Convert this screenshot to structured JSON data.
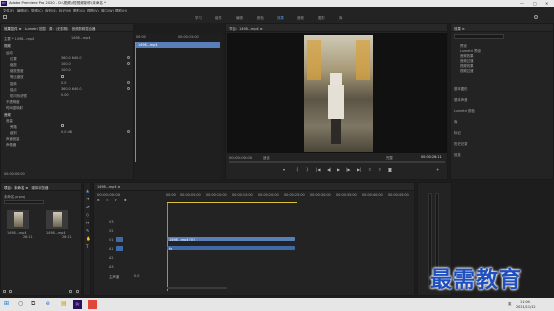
{
  "window": {
    "title": "Adobe Premiere Pro 2020 - D:\\视频\\\\短视频制作\\未命名 *",
    "minimize": "—",
    "maximize": "□",
    "close": "✕"
  },
  "menu": [
    "文件(F)",
    "编辑(E)",
    "剪辑(C)",
    "序列(S)",
    "标记(M)",
    "图形(G)",
    "视图(V)",
    "窗口(W)",
    "帮助(H)"
  ],
  "workspaces": [
    {
      "label": "学习",
      "active": false
    },
    {
      "label": "组件",
      "active": false
    },
    {
      "label": "编辑",
      "active": false
    },
    {
      "label": "颜色",
      "active": false
    },
    {
      "label": "效果",
      "active": true
    },
    {
      "label": "音频",
      "active": false
    },
    {
      "label": "图形",
      "active": false
    },
    {
      "label": "库",
      "active": false
    }
  ],
  "effect_controls": {
    "tabs": [
      "效果控件 ≡",
      "Lumetri 范围",
      "源：(无剪辑)",
      "音频剪辑混合器"
    ],
    "source_label": "主要 * 1498...mp4",
    "clip_label": "1498...mp4",
    "video_header": "视频",
    "rows": [
      "运动",
      "位置",
      "缩放",
      "缩放宽度",
      "等比缩放",
      "旋转",
      "锚点",
      "防闪烁滤镜",
      "不透明度",
      "时间重映射"
    ],
    "values": [
      "360.0  640.0",
      "100.0",
      "100.0",
      "✓",
      "0.0",
      "360.0  640.0",
      "0.00"
    ],
    "audio_header": "音频",
    "audio_rows": [
      "音量",
      "旁路",
      "级别",
      "声道音量",
      "声像器"
    ],
    "audio_values": [
      "0.0 dB"
    ],
    "timecode": "00:00:00:00"
  },
  "source_clip": {
    "ruler_start": "00:00",
    "ruler_mid": "00:00:15:00",
    "clip_label": "1498...mp4"
  },
  "program_monitor": {
    "tab": "节目：1498...mp4 ≡",
    "timecode_left": "00:00:00:00",
    "fit": "适合",
    "quality": "完整",
    "timecode_right": "00:00:28:11"
  },
  "project": {
    "tabs": [
      "项目：未命名 ≡",
      "媒体浏览器"
    ],
    "name": "未命名.prproj",
    "items": [
      {
        "name": "1498...mp4",
        "duration": "28:11"
      },
      {
        "name": "1498...mp4",
        "duration": "28:11"
      }
    ]
  },
  "timeline": {
    "tab": "1498...mp4 ≡",
    "timecode": "00:00:00:00",
    "ruler": [
      "00:00",
      "00:00:05:00",
      "00:00:10:00",
      "00:00:15:00",
      "00:00:20:00",
      "00:00:25:00",
      "00:00:30:00",
      "00:00:35:00",
      "00:00:40:00",
      "00:00:45:00"
    ],
    "tracks": [
      "V3",
      "V2",
      "V1",
      "A1",
      "A2",
      "A3"
    ],
    "mix_label": "主声道",
    "mix_value": "0.0",
    "video_clip": "1498...mp4 [V]",
    "audio_clip": "fx"
  },
  "effects_panel": {
    "tab": "效果 ≡",
    "items": [
      "预设",
      "Lumetri 预设",
      "音频效果",
      "音频过渡",
      "视频效果",
      "视频过渡"
    ],
    "sections": [
      "基本图形",
      "基本声音",
      "Lumetri 颜色",
      "库",
      "标记",
      "历史记录",
      "信息"
    ]
  },
  "watermark": {
    "text": "最需教育"
  },
  "taskbar": {
    "time": "11:04",
    "date": "2021/11/12",
    "lang": "英"
  },
  "colors": {
    "accent": "#4f9be8",
    "video_clip": "#5a7fb8",
    "audio_clip": "#3f6aa5",
    "panel": "#232323"
  }
}
